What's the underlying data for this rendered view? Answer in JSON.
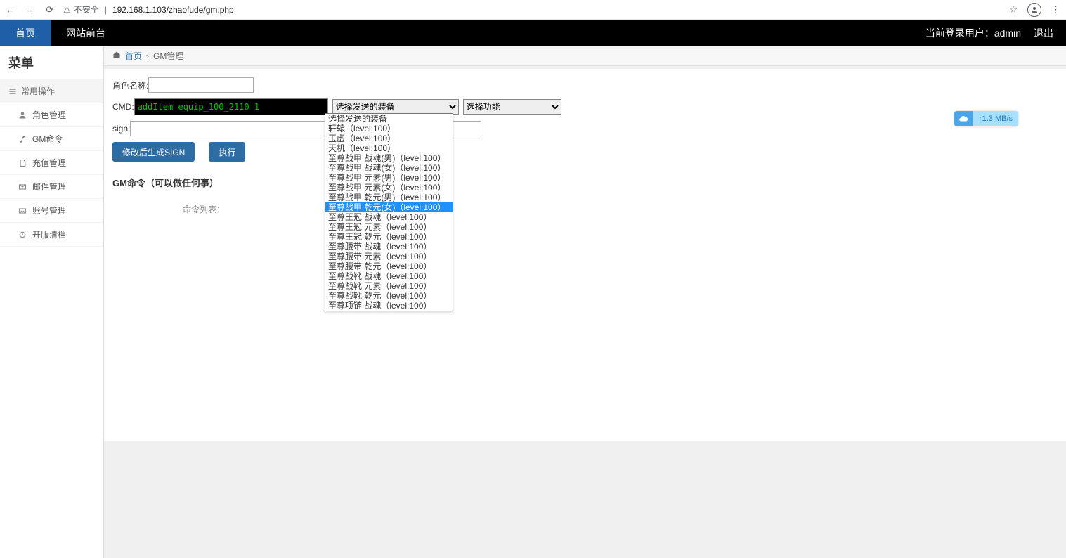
{
  "browser": {
    "insecure_label": "不安全",
    "url": "192.168.1.103/zhaofude/gm.php"
  },
  "topnav": {
    "tab_home": "首页",
    "tab_front": "网站前台",
    "current_user_label": "当前登录用户：admin",
    "logout": "退出"
  },
  "sidebar": {
    "title": "菜单",
    "section": "常用操作",
    "items": [
      {
        "label": "角色管理",
        "icon": "users"
      },
      {
        "label": "GM命令",
        "icon": "wrench"
      },
      {
        "label": "充值管理",
        "icon": "file"
      },
      {
        "label": "邮件管理",
        "icon": "mail"
      },
      {
        "label": "账号管理",
        "icon": "envelope"
      },
      {
        "label": "开服清档",
        "icon": "power"
      }
    ]
  },
  "breadcrumb": {
    "home": "首页",
    "current": "GM管理",
    "sep": "›"
  },
  "form": {
    "role_label": "角色名称:",
    "role_value": "",
    "cmd_label": "CMD:",
    "cmd_value": "addItem equip_100_2110 1",
    "select_equip_label": "选择发送的装备",
    "select_func_label": "选择功能",
    "sign_label": "sign:",
    "sign_value": "",
    "btn_generate": "修改后生成SIGN",
    "btn_execute": "执行",
    "gm_title": "GM命令（可以做任何事）",
    "cmd_list_label": "命令列表："
  },
  "equip_options": [
    "选择发送的装备",
    "轩辕（level:100）",
    "玉虚（level:100）",
    "天机（level:100）",
    "至尊战甲 战魂(男)（level:100）",
    "至尊战甲 战魂(女)（level:100）",
    "至尊战甲 元素(男)（level:100）",
    "至尊战甲 元素(女)（level:100）",
    "至尊战甲 乾元(男)（level:100）",
    "至尊战甲 乾元(女)（level:100）",
    "至尊王冠 战魂（level:100）",
    "至尊王冠 元素（level:100）",
    "至尊王冠 乾元（level:100）",
    "至尊腰带 战魂（level:100）",
    "至尊腰带 元素（level:100）",
    "至尊腰带 乾元（level:100）",
    "至尊战靴 战魂（level:100）",
    "至尊战靴 元素（level:100）",
    "至尊战靴 乾元（level:100）",
    "至尊项链 战魂（level:100）"
  ],
  "equip_selected_index": 9,
  "speed_badge": {
    "text": "1.3 MB/s"
  }
}
